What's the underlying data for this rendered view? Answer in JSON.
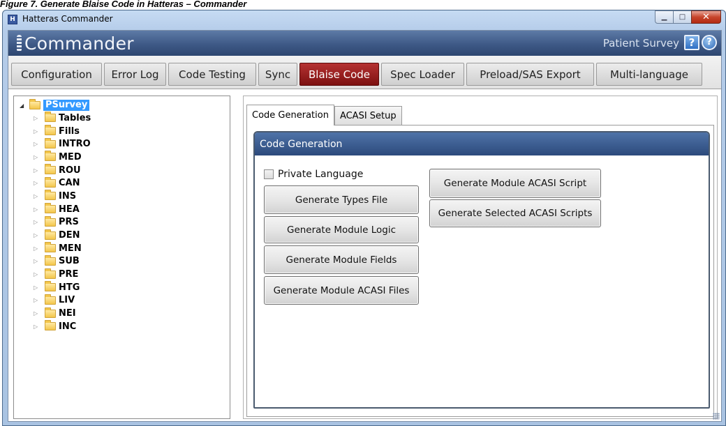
{
  "caption": "Figure 7. Generate Blaise Code in Hatteras – Commander",
  "window": {
    "title": "Hatteras Commander",
    "app_icon_letter": "H",
    "controls": {
      "minimize": "▁",
      "maximize": "□",
      "close": "✕"
    }
  },
  "banner": {
    "logo_text": "Commander",
    "survey_name": "Patient Survey",
    "help_glyph": "?",
    "info_glyph": "?"
  },
  "main_tabs": [
    {
      "label": "Configuration",
      "active": false
    },
    {
      "label": "Error Log",
      "active": false
    },
    {
      "label": "Code Testing",
      "active": false
    },
    {
      "label": "Sync",
      "active": false
    },
    {
      "label": "Blaise Code",
      "active": true
    },
    {
      "label": "Spec Loader",
      "active": false
    },
    {
      "label": "Preload/SAS Export",
      "active": false
    },
    {
      "label": "Multi-language",
      "active": false
    }
  ],
  "tree": {
    "root": {
      "label": "PSurvey",
      "expanded": true,
      "selected": true
    },
    "items": [
      "Tables",
      "Fills",
      "INTRO",
      "MED",
      "ROU",
      "CAN",
      "INS",
      "HEA",
      "PRS",
      "DEN",
      "MEN",
      "SUB",
      "PRE",
      "HTG",
      "LIV",
      "NEI",
      "INC"
    ],
    "expanded_glyph": "◢",
    "collapsed_glyph": "▷"
  },
  "sub_tabs": [
    {
      "label": "Code Generation",
      "active": true
    },
    {
      "label": "ACASI Setup",
      "active": false
    }
  ],
  "code_generation": {
    "header": "Code Generation",
    "private_language": {
      "label": "Private Language",
      "checked": false
    },
    "left_buttons": [
      "Generate Types File",
      "Generate Module Logic",
      "Generate Module Fields",
      "Generate Module ACASI Files"
    ],
    "right_buttons": [
      "Generate Module ACASI Script",
      "Generate Selected ACASI Scripts"
    ]
  }
}
